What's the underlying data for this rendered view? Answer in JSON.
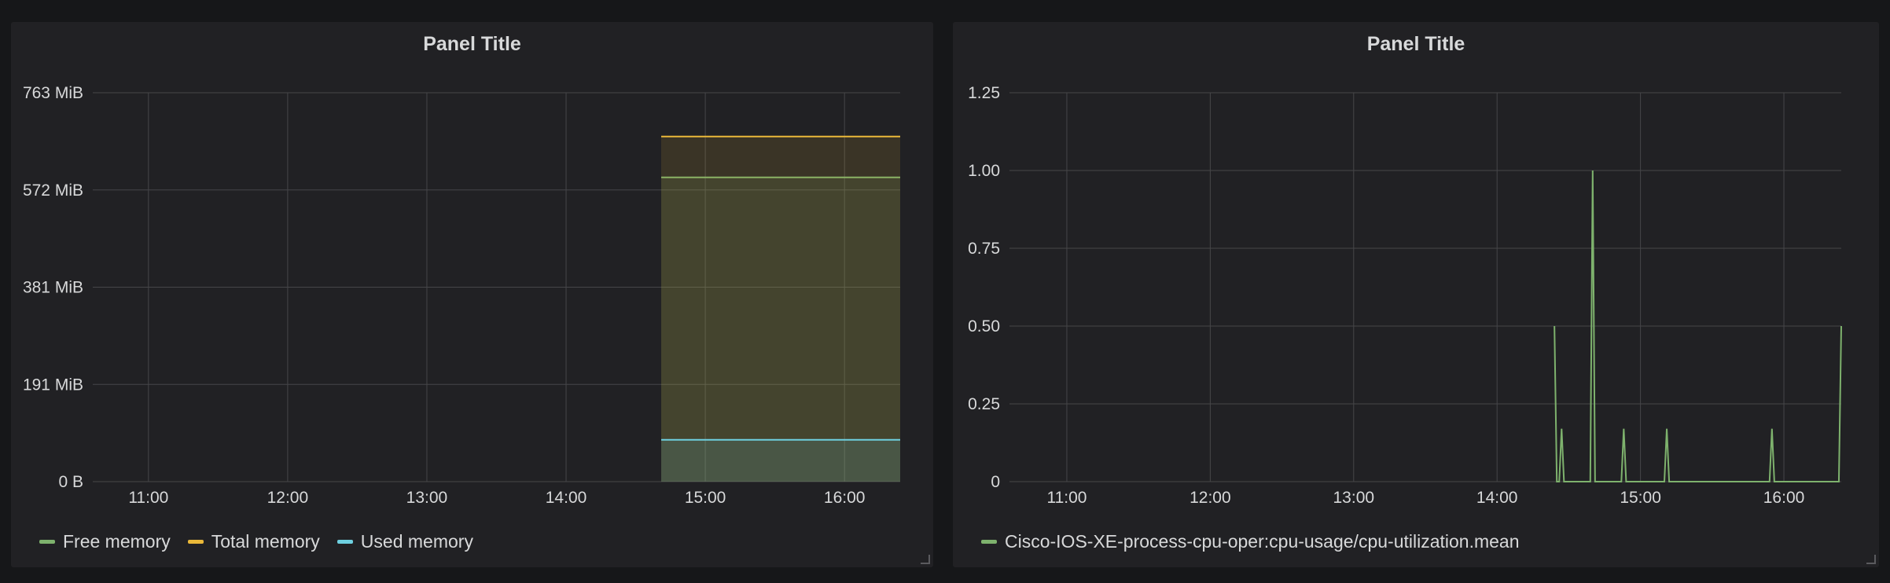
{
  "chart_data": [
    {
      "type": "area",
      "title": "Panel Title",
      "xlabel": "",
      "ylabel": "",
      "x_ticks": [
        "11:00",
        "12:00",
        "13:00",
        "14:00",
        "15:00",
        "16:00"
      ],
      "y_ticks": [
        "0 B",
        "191 MiB",
        "381 MiB",
        "572 MiB",
        "763 MiB"
      ],
      "x_range": [
        "10:36",
        "16:24"
      ],
      "ylim": [
        0,
        763
      ],
      "y_unit": "MiB",
      "grid": true,
      "legend_position": "bottom-left",
      "series": [
        {
          "name": "Free memory",
          "color": "#7eb26d",
          "fill": true,
          "x": [
            "14:41",
            "16:24"
          ],
          "y": [
            597,
            597
          ]
        },
        {
          "name": "Total memory",
          "color": "#eab839",
          "fill": true,
          "x": [
            "14:41",
            "16:24"
          ],
          "y": [
            677,
            677
          ]
        },
        {
          "name": "Used memory",
          "color": "#6ed0e0",
          "fill": true,
          "x": [
            "14:41",
            "16:24"
          ],
          "y": [
            82,
            82
          ]
        }
      ]
    },
    {
      "type": "line",
      "title": "Panel Title",
      "xlabel": "",
      "ylabel": "",
      "x_ticks": [
        "11:00",
        "12:00",
        "13:00",
        "14:00",
        "15:00",
        "16:00"
      ],
      "y_ticks": [
        "0",
        "0.25",
        "0.50",
        "0.75",
        "1.00",
        "1.25"
      ],
      "x_range": [
        "10:36",
        "16:24"
      ],
      "ylim": [
        0,
        1.25
      ],
      "grid": true,
      "legend_position": "bottom-left",
      "series": [
        {
          "name": "Cisco-IOS-XE-process-cpu-oper:cpu-usage/cpu-utilization.mean",
          "color": "#7eb26d",
          "fill": false,
          "x": [
            "14:24",
            "14:25",
            "14:26",
            "14:27",
            "14:28",
            "14:29",
            "14:30",
            "14:39",
            "14:40",
            "14:41",
            "14:52",
            "14:53",
            "14:54",
            "15:10",
            "15:11",
            "15:12",
            "15:54",
            "15:55",
            "15:56",
            "16:23",
            "16:24"
          ],
          "y": [
            0.5,
            0,
            0,
            0.17,
            0,
            0,
            0,
            0,
            1.0,
            0,
            0,
            0.17,
            0,
            0,
            0.17,
            0,
            0,
            0.17,
            0,
            0,
            0.5
          ]
        }
      ]
    }
  ]
}
